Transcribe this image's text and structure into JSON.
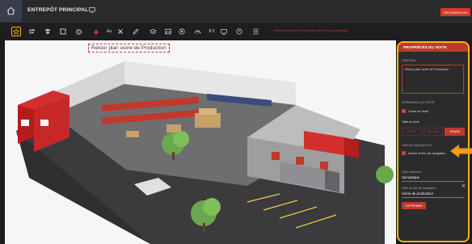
{
  "app": {
    "title": "ENTREPÔT PRINCIPAL",
    "exit_label": "DÉCONNEXION"
  },
  "toolbar": {
    "font_label": "Aa",
    "zoom_value": "8:9",
    "hint": "Sélectionnez un élément pour afficher ses propriétés"
  },
  "canvas": {
    "label_text": "Retour plan usine de Production"
  },
  "panel": {
    "header": "PROPRIÉTÉS DU TEXTE",
    "content_section": "CONTENU",
    "content_text": "Retour plan usine de Production",
    "appearance_section": "APPARENCE DU TEXTE",
    "frame_label": "Cadre de texte",
    "frame_checked": true,
    "size_section": "Taille du texte",
    "sizes": [
      "PETIT",
      "MOYEN",
      "GRAND"
    ],
    "selected_size": "GRAND",
    "link_section": "LIEN DE NAVIGATION",
    "link_label": "Activer le lien de navigation",
    "link_checked": true,
    "type_section": "Type d'élément",
    "type_value": "Synoptique",
    "target_section": "Cible du lien de navigation",
    "target_value": "Usine de production",
    "delete_label": "SUPPRIMER"
  },
  "colors": {
    "accent": "#c0392b",
    "highlight": "#f2b705",
    "arrow": "#f39c12"
  }
}
